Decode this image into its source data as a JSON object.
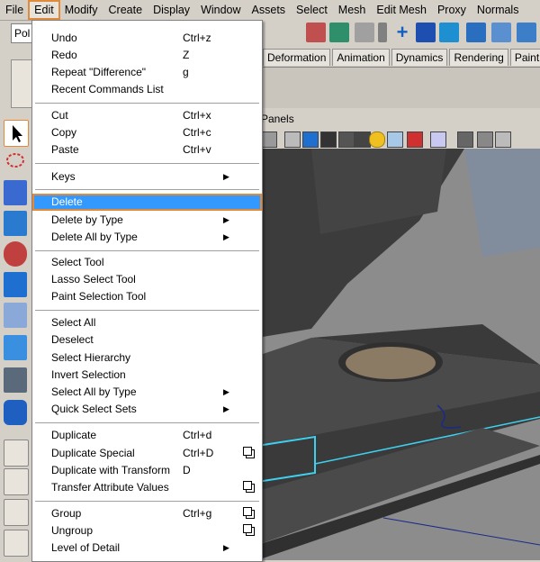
{
  "menubar": {
    "items": [
      "File",
      "Edit",
      "Modify",
      "Create",
      "Display",
      "Window",
      "Assets",
      "Select",
      "Mesh",
      "Edit Mesh",
      "Proxy",
      "Normals"
    ]
  },
  "left": {
    "field_text": "Pol"
  },
  "tabs": [
    "Deformation",
    "Animation",
    "Dynamics",
    "Rendering",
    "PaintEffe"
  ],
  "panels": {
    "label": "Panels"
  },
  "edit_menu": {
    "groups": [
      [
        {
          "label": "Undo",
          "shortcut": "Ctrl+z"
        },
        {
          "label": "Redo",
          "shortcut": "Z"
        },
        {
          "label": "Repeat \"Difference\"",
          "shortcut": "g"
        },
        {
          "label": "Recent Commands List",
          "shortcut": ""
        }
      ],
      [
        {
          "label": "Cut",
          "shortcut": "Ctrl+x"
        },
        {
          "label": "Copy",
          "shortcut": "Ctrl+c"
        },
        {
          "label": "Paste",
          "shortcut": "Ctrl+v"
        }
      ],
      [
        {
          "label": "Keys",
          "shortcut": "",
          "submenu": true
        }
      ],
      [
        {
          "label": "Delete",
          "shortcut": "",
          "highlighted": true
        },
        {
          "label": "Delete by Type",
          "shortcut": "",
          "submenu": true
        },
        {
          "label": "Delete All by Type",
          "shortcut": "",
          "submenu": true
        }
      ],
      [
        {
          "label": "Select Tool",
          "shortcut": ""
        },
        {
          "label": "Lasso Select Tool",
          "shortcut": ""
        },
        {
          "label": "Paint Selection Tool",
          "shortcut": ""
        }
      ],
      [
        {
          "label": "Select All",
          "shortcut": ""
        },
        {
          "label": "Deselect",
          "shortcut": ""
        },
        {
          "label": "Select Hierarchy",
          "shortcut": ""
        },
        {
          "label": "Invert Selection",
          "shortcut": ""
        },
        {
          "label": "Select All by Type",
          "shortcut": "",
          "submenu": true
        },
        {
          "label": "Quick Select Sets",
          "shortcut": "",
          "submenu": true
        }
      ],
      [
        {
          "label": "Duplicate",
          "shortcut": "Ctrl+d"
        },
        {
          "label": "Duplicate Special",
          "shortcut": "Ctrl+D",
          "option_box": true
        },
        {
          "label": "Duplicate with Transform",
          "shortcut": "D"
        },
        {
          "label": "Transfer Attribute Values",
          "shortcut": "",
          "option_box": true
        }
      ],
      [
        {
          "label": "Group",
          "shortcut": "Ctrl+g",
          "option_box": true
        },
        {
          "label": "Ungroup",
          "shortcut": "",
          "option_box": true
        },
        {
          "label": "Level of Detail",
          "shortcut": "",
          "submenu": true
        }
      ]
    ]
  },
  "colors": {
    "accent_outline": "#e08a3c",
    "highlight": "#3399ff"
  }
}
